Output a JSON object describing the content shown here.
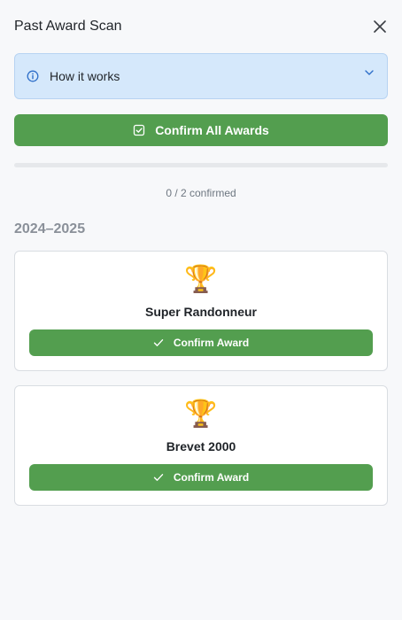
{
  "header": {
    "title": "Past Award Scan",
    "close_icon": "close-icon"
  },
  "info": {
    "label": "How it works",
    "icon": "info-icon",
    "chevron": "chevron-down-icon"
  },
  "confirm_all": {
    "label": "Confirm All Awards",
    "icon": "checkbox-check-icon"
  },
  "progress": {
    "text": "0 / 2 confirmed",
    "confirmed": 0,
    "total": 2
  },
  "season": {
    "label": "2024–2025",
    "awards": [
      {
        "emoji": "🏆",
        "name": "Super Randonneur",
        "button_label": "Confirm Award"
      },
      {
        "emoji": "🏆",
        "name": "Brevet 2000",
        "button_label": "Confirm Award"
      }
    ]
  },
  "colors": {
    "accent_green": "#539e4f",
    "info_bg": "#d5e8fb",
    "info_icon": "#2f6fc9"
  }
}
